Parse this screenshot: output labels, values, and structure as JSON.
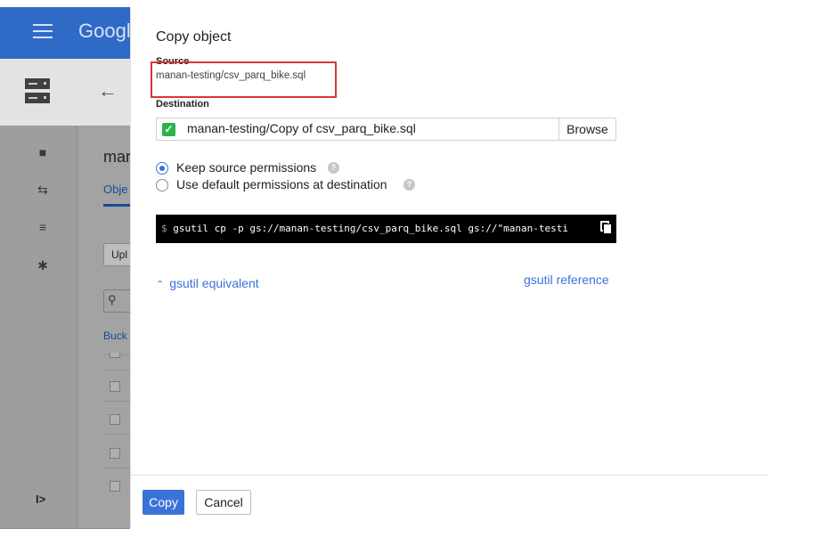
{
  "background_app": {
    "brand": "Googl",
    "back_icon": "arrow-left-icon",
    "bucket_title": "mar",
    "tab_objects": "Obje",
    "upload_button": "Upl",
    "buckets_link": "Buck",
    "nav_icons": [
      "storage-icon",
      "transfer-icon",
      "list-icon",
      "settings-icon"
    ],
    "collapse_label": "I>"
  },
  "dialog": {
    "title": "Copy object",
    "source": {
      "label": "Source",
      "value": "manan-testing/csv_parq_bike.sql",
      "highlight_color": "#d93434"
    },
    "destination": {
      "label": "Destination",
      "value": "manan-testing/Copy of csv_parq_bike.sql",
      "valid": true,
      "browse_label": "Browse"
    },
    "permissions": {
      "options": [
        {
          "label": "Keep source permissions",
          "checked": true
        },
        {
          "label": "Use default permissions at destination",
          "checked": false
        }
      ]
    },
    "command": {
      "prompt": "$",
      "text": "gsutil cp -p gs://manan-testing/csv_parq_bike.sql gs://\"manan-testi"
    },
    "gsutil_equivalent": "gsutil equivalent",
    "gsutil_reference": "gsutil reference",
    "buttons": {
      "copy": "Copy",
      "cancel": "Cancel"
    }
  },
  "colors": {
    "accent": "#3a72d8",
    "topbar": "#2f6bc6",
    "success": "#2bb34a"
  }
}
